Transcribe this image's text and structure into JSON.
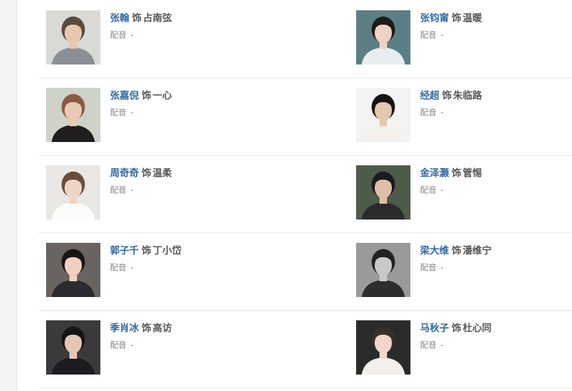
{
  "cast": [
    [
      {
        "actor": "张翰",
        "sep": "饰",
        "role": "占南弦",
        "voice_label": "配音",
        "voice_value": "-",
        "photo": {
          "bg": "#d9d9d6",
          "skin": "#e8c8ad",
          "hair": "#5a4a3e",
          "cloth": "#8a8f96"
        }
      },
      {
        "actor": "张钧甯",
        "sep": "饰",
        "role": "温暖",
        "voice_label": "配音",
        "voice_value": "-",
        "photo": {
          "bg": "#5c7f86",
          "skin": "#ecd3c2",
          "hair": "#1e1a18",
          "cloth": "#e9edf1"
        }
      }
    ],
    [
      {
        "actor": "张嘉倪",
        "sep": "饰",
        "role": "一心",
        "voice_label": "配音",
        "voice_value": "-",
        "photo": {
          "bg": "#cfd2c8",
          "skin": "#e8c9b4",
          "hair": "#8a5a48",
          "cloth": "#1f1d1e"
        }
      },
      {
        "actor": "经超",
        "sep": "饰",
        "role": "朱临路",
        "voice_label": "配音",
        "voice_value": "-",
        "photo": {
          "bg": "#f3f3f3",
          "skin": "#e6c7b0",
          "hair": "#141414",
          "cloth": "#f5f1ea"
        }
      }
    ],
    [
      {
        "actor": "周奇奇",
        "sep": "饰",
        "role": "温柔",
        "voice_label": "配音",
        "voice_value": "-",
        "photo": {
          "bg": "#e9e7e4",
          "skin": "#f0d4c3",
          "hair": "#6b4c3b",
          "cloth": "#fbfbfb"
        }
      },
      {
        "actor": "金泽灏",
        "sep": "饰",
        "role": "管惕",
        "voice_label": "配音",
        "voice_value": "-",
        "photo": {
          "bg": "#4e5a4a",
          "skin": "#dfc0a6",
          "hair": "#1b1b1b",
          "cloth": "#2a2a2c"
        }
      }
    ],
    [
      {
        "actor": "郭子千",
        "sep": "饰",
        "role": "丁小岱",
        "voice_label": "配音",
        "voice_value": "-",
        "photo": {
          "bg": "#6a6461",
          "skin": "#f0d0c0",
          "hair": "#1a1516",
          "cloth": "#2b2b2f"
        }
      },
      {
        "actor": "梁大维",
        "sep": "饰",
        "role": "潘维宁",
        "voice_label": "配音",
        "voice_value": "-",
        "photo": {
          "bg": "#9a9a9a",
          "skin": "#c9c9c9",
          "hair": "#222222",
          "cloth": "#2d2d2d"
        }
      }
    ],
    [
      {
        "actor": "季肖冰",
        "sep": "饰",
        "role": "高访",
        "voice_label": "配音",
        "voice_value": "-",
        "photo": {
          "bg": "#3a3a3d",
          "skin": "#e4c6b2",
          "hair": "#151515",
          "cloth": "#1c1c1e"
        }
      },
      {
        "actor": "马秋子",
        "sep": "饰",
        "role": "杜心同",
        "voice_label": "配音",
        "voice_value": "-",
        "photo": {
          "bg": "#2a2a2a",
          "skin": "#f0d6c8",
          "hair": "#3a2e2a",
          "cloth": "#f2eee9"
        }
      }
    ]
  ]
}
